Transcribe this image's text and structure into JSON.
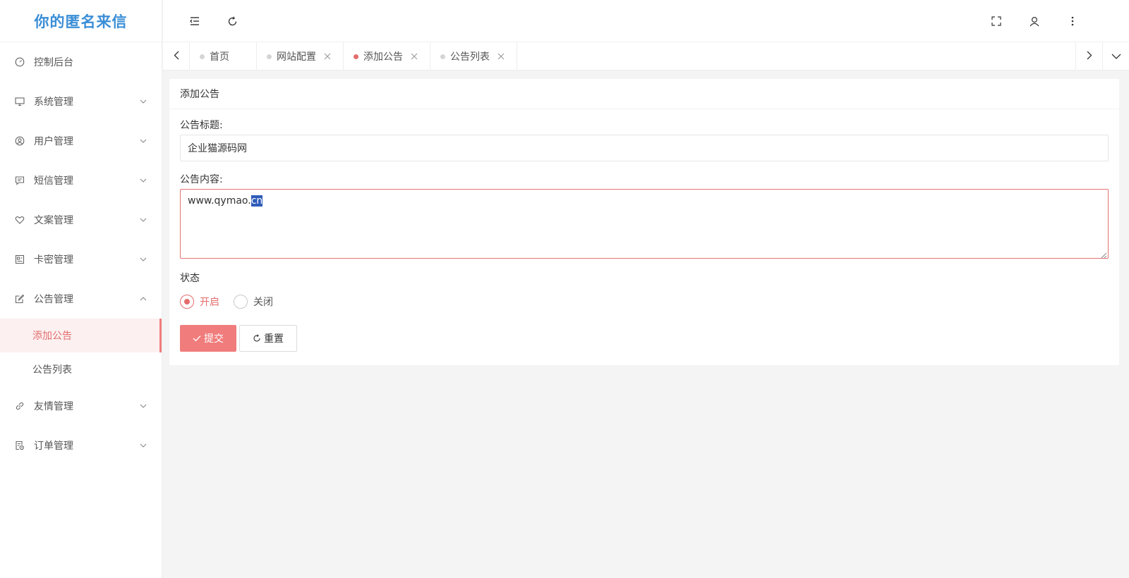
{
  "app": {
    "title": "你的匿名来信"
  },
  "sidebar": {
    "items": [
      {
        "label": "控制后台",
        "icon": "dashboard-icon"
      },
      {
        "label": "系统管理",
        "icon": "monitor-icon"
      },
      {
        "label": "用户管理",
        "icon": "user-circle-icon"
      },
      {
        "label": "短信管理",
        "icon": "message-icon"
      },
      {
        "label": "文案管理",
        "icon": "heart-icon"
      },
      {
        "label": "卡密管理",
        "icon": "card-icon"
      },
      {
        "label": "公告管理",
        "icon": "edit-icon",
        "expanded": true,
        "children": [
          {
            "label": "添加公告",
            "active": true
          },
          {
            "label": "公告列表"
          }
        ]
      },
      {
        "label": "友情管理",
        "icon": "link-icon"
      },
      {
        "label": "订单管理",
        "icon": "order-icon"
      }
    ]
  },
  "tabs": [
    {
      "label": "首页",
      "closable": false
    },
    {
      "label": "网站配置",
      "closable": true
    },
    {
      "label": "添加公告",
      "closable": true,
      "active": true
    },
    {
      "label": "公告列表",
      "closable": true
    }
  ],
  "card": {
    "title": "添加公告",
    "fields": {
      "title_label": "公告标题:",
      "title_value": "企业猫源码网",
      "content_label": "公告内容:",
      "content_value_plain": "www.qymao.",
      "content_value_selected": "cn",
      "status_label": "状态",
      "status_options": [
        "开启",
        "关闭"
      ],
      "status_selected": "开启"
    },
    "buttons": {
      "submit": "提交",
      "reset": "重置"
    }
  },
  "colors": {
    "accent": "#f07c7c",
    "brand": "#3b8ed6",
    "selection": "#2f5cb9"
  }
}
